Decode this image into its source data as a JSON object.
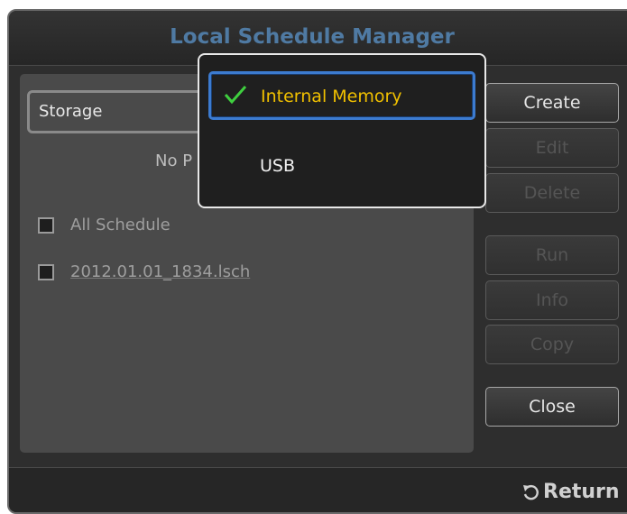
{
  "window": {
    "title": "Local Schedule Manager"
  },
  "storage": {
    "label": "Storage"
  },
  "list": {
    "empty_text": "No P",
    "items": [
      {
        "label": "All Schedule"
      },
      {
        "label": "2012.01.01_1834.lsch"
      }
    ]
  },
  "buttons": {
    "create": "Create",
    "edit": "Edit",
    "delete": "Delete",
    "run": "Run",
    "info": "Info",
    "copy": "Copy",
    "close": "Close"
  },
  "footer": {
    "return_label": "Return"
  },
  "dropdown": {
    "options": [
      {
        "label": "Internal Memory",
        "selected": true
      },
      {
        "label": "USB",
        "selected": false
      }
    ]
  },
  "colors": {
    "title": "#4f7aa3",
    "selection_border": "#3c7bd0",
    "selected_text": "#f0c000",
    "check": "#3fcf3f"
  },
  "icons": {
    "check": "check-icon",
    "return": "return-arrow-icon"
  }
}
